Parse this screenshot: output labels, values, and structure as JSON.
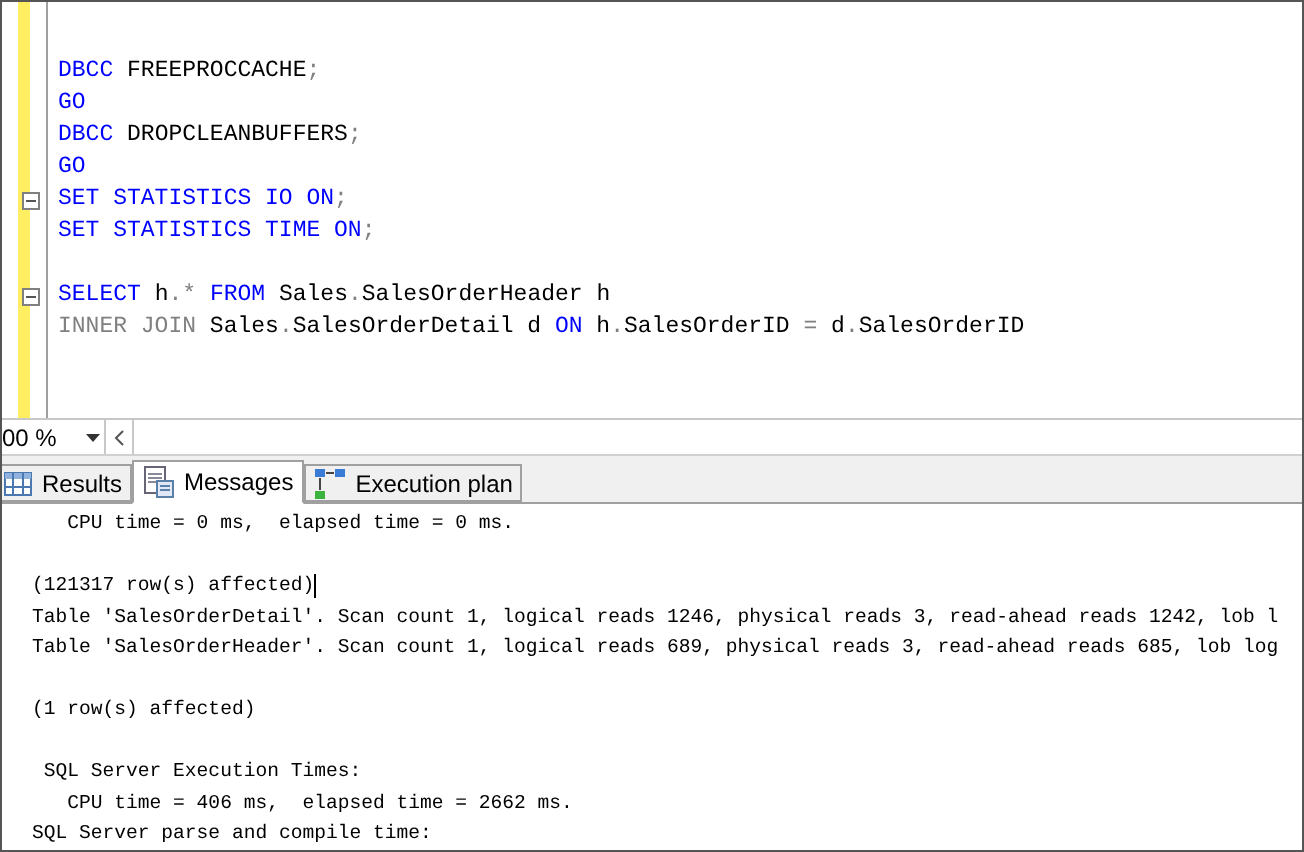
{
  "editor": {
    "blocks": [
      [
        {
          "fold": false,
          "tokens": [
            {
              "kind": "keyword",
              "text": "DBCC"
            },
            {
              "kind": "plain",
              "text": " FREEPROCCACHE"
            },
            {
              "kind": "punct",
              "text": ";"
            }
          ]
        },
        {
          "fold": false,
          "tokens": [
            {
              "kind": "keyword",
              "text": "GO"
            }
          ]
        },
        {
          "fold": false,
          "tokens": [
            {
              "kind": "keyword",
              "text": "DBCC"
            },
            {
              "kind": "plain",
              "text": " DROPCLEANBUFFERS"
            },
            {
              "kind": "punct",
              "text": ";"
            }
          ]
        },
        {
          "fold": false,
          "tokens": [
            {
              "kind": "keyword",
              "text": "GO"
            }
          ]
        },
        {
          "fold": true,
          "tokens": [
            {
              "kind": "keyword",
              "text": "SET STATISTICS IO ON"
            },
            {
              "kind": "punct",
              "text": ";"
            }
          ]
        },
        {
          "fold": false,
          "tokens": [
            {
              "kind": "keyword",
              "text": "SET STATISTICS TIME ON"
            },
            {
              "kind": "punct",
              "text": ";"
            }
          ]
        }
      ],
      [
        {
          "fold": true,
          "tokens": [
            {
              "kind": "keyword",
              "text": "SELECT"
            },
            {
              "kind": "plain",
              "text": " h"
            },
            {
              "kind": "punct",
              "text": "."
            },
            {
              "kind": "punct",
              "text": "*"
            },
            {
              "kind": "keyword",
              "text": " FROM"
            },
            {
              "kind": "plain",
              "text": " Sales"
            },
            {
              "kind": "punct",
              "text": "."
            },
            {
              "kind": "plain",
              "text": "SalesOrderHeader h"
            }
          ]
        },
        {
          "fold": false,
          "tokens": [
            {
              "kind": "punct",
              "text": "INNER JOIN"
            },
            {
              "kind": "plain",
              "text": " Sales"
            },
            {
              "kind": "punct",
              "text": "."
            },
            {
              "kind": "plain",
              "text": "SalesOrderDetail d "
            },
            {
              "kind": "keyword",
              "text": "ON"
            },
            {
              "kind": "plain",
              "text": " h"
            },
            {
              "kind": "punct",
              "text": "."
            },
            {
              "kind": "plain",
              "text": "SalesOrderID "
            },
            {
              "kind": "punct",
              "text": "="
            },
            {
              "kind": "plain",
              "text": " d"
            },
            {
              "kind": "punct",
              "text": "."
            },
            {
              "kind": "plain",
              "text": "SalesOrderID"
            }
          ]
        }
      ]
    ]
  },
  "zoom": {
    "value": "00 %"
  },
  "tabs": [
    {
      "label": "Results",
      "selected": false
    },
    {
      "label": "Messages",
      "selected": true
    },
    {
      "label": "Execution plan",
      "selected": false
    }
  ],
  "messages": {
    "blocks": [
      [
        {
          "text": "   CPU time = 0 ms,  elapsed time = 0 ms.",
          "cursor": false
        }
      ],
      [
        {
          "text": "(121317 row(s) affected)",
          "cursor": true
        },
        {
          "text": "Table 'SalesOrderDetail'. Scan count 1, logical reads 1246, physical reads 3, read-ahead reads 1242, lob l",
          "cursor": false
        },
        {
          "text": "Table 'SalesOrderHeader'. Scan count 1, logical reads 689, physical reads 3, read-ahead reads 685, lob log",
          "cursor": false
        }
      ],
      [
        {
          "text": "(1 row(s) affected)",
          "cursor": false
        }
      ],
      [
        {
          "text": " SQL Server Execution Times:",
          "cursor": false
        },
        {
          "text": "   CPU time = 406 ms,  elapsed time = 2662 ms.",
          "cursor": false
        },
        {
          "text": "SQL Server parse and compile time:",
          "cursor": false
        }
      ]
    ]
  }
}
